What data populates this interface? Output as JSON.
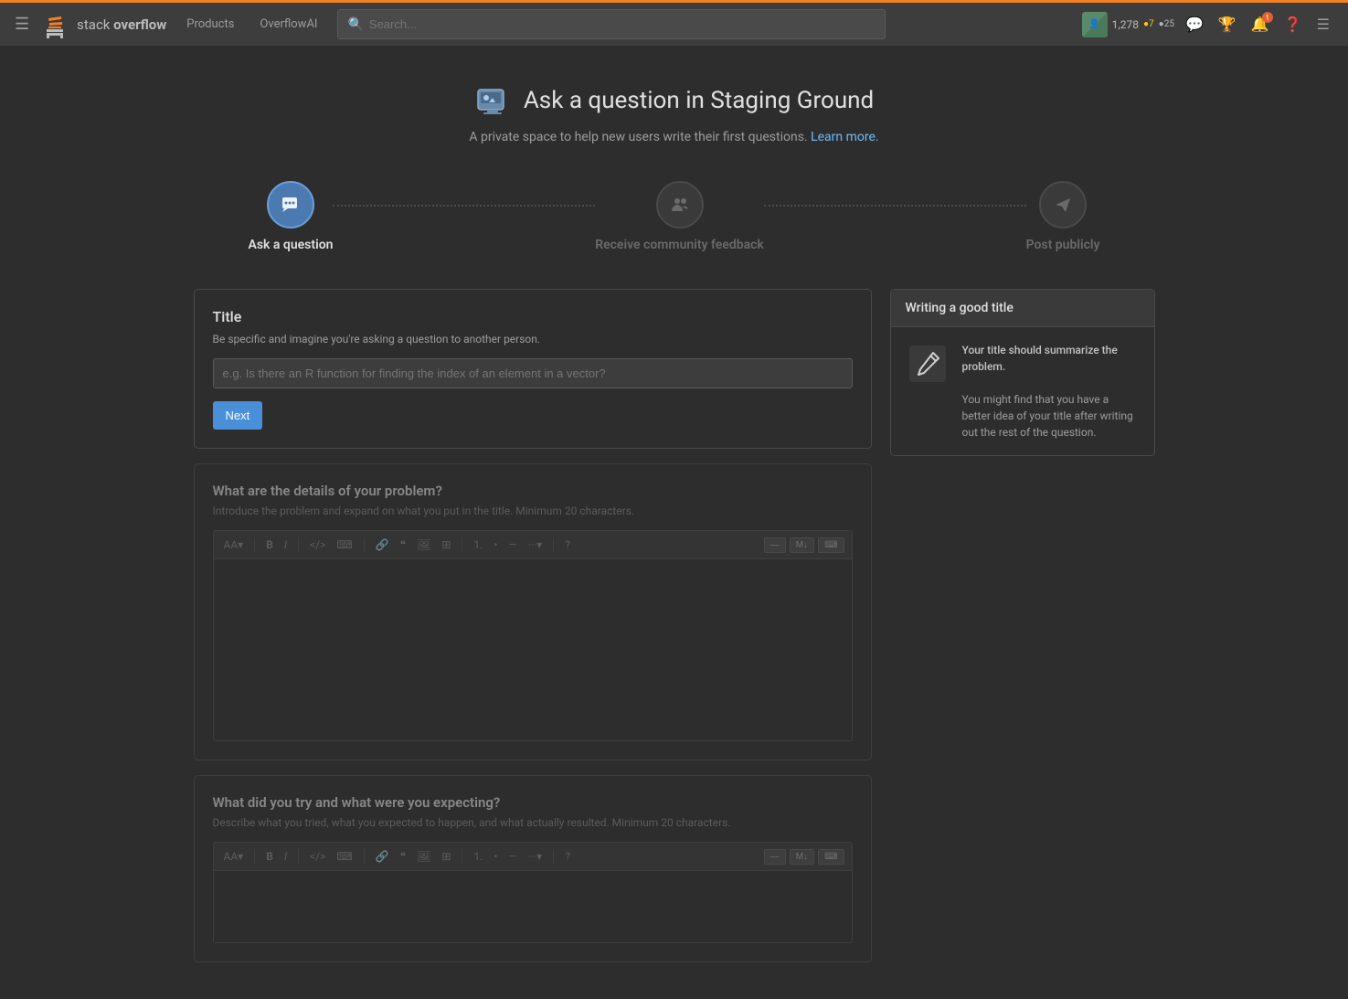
{
  "navbar": {
    "logo_text": "stack overflow",
    "products_label": "Products",
    "overflowai_label": "OverflowAI",
    "search_placeholder": "Search...",
    "user_rep": "1,278",
    "gold_count": "7",
    "silver_count": "25"
  },
  "page": {
    "title": "Ask a question in Staging Ground",
    "subtitle": "A private space to help new users write their first questions.",
    "learn_more": "Learn more."
  },
  "steps": [
    {
      "label": "Ask a question",
      "active": true
    },
    {
      "label": "Receive community feedback",
      "active": false
    },
    {
      "label": "Post publicly",
      "active": false
    }
  ],
  "title_section": {
    "heading": "Title",
    "hint": "Be specific and imagine you're asking a question to another person.",
    "placeholder": "e.g. Is there an R function for finding the index of an element in a vector?",
    "next_btn": "Next"
  },
  "sidebar": {
    "heading": "Writing a good title",
    "tip_strong": "Your title should summarize the problem.",
    "tip_body": "You might find that you have a better idea of your title after writing out the rest of the question."
  },
  "problem_section": {
    "heading": "What are the details of your problem?",
    "hint": "Introduce the problem and expand on what you put in the title. Minimum 20 characters.",
    "toolbar_modes": [
      "—",
      "M↓",
      "⌨"
    ]
  },
  "try_section": {
    "heading": "What did you try and what were you expecting?",
    "hint": "Describe what you tried, what you expected to happen, and what actually resulted. Minimum 20 characters.",
    "toolbar_modes": [
      "—",
      "M↓",
      "⌨"
    ]
  }
}
